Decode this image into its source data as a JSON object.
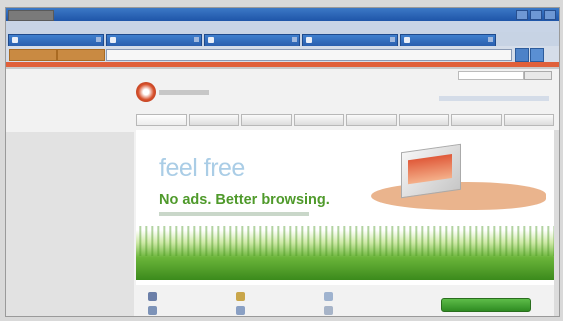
{
  "window": {
    "title": "",
    "controls": [
      "minimize",
      "maximize",
      "close"
    ]
  },
  "menubar": {
    "items": []
  },
  "tabs": [
    {
      "label": ""
    },
    {
      "label": ""
    },
    {
      "label": ""
    },
    {
      "label": ""
    },
    {
      "label": ""
    }
  ],
  "addressbar": {
    "url": ""
  },
  "site": {
    "search_button": "",
    "nav": [
      {
        "label": ""
      },
      {
        "label": ""
      },
      {
        "label": ""
      },
      {
        "label": ""
      },
      {
        "label": ""
      },
      {
        "label": ""
      },
      {
        "label": ""
      },
      {
        "label": ""
      }
    ],
    "hero": {
      "headline": "feel free",
      "tagline": "No ads. Better browsing."
    },
    "features": [
      {
        "label": "",
        "icon": "lock-icon"
      },
      {
        "label": "",
        "icon": "search-icon"
      },
      {
        "label": "",
        "icon": "tabs-icon"
      },
      {
        "label": "",
        "icon": "mail-icon"
      },
      {
        "label": "",
        "icon": "globe-icon"
      },
      {
        "label": "",
        "icon": "gear-icon"
      }
    ],
    "download_label": ""
  },
  "colors": {
    "titlebar": "#2a62b4",
    "brand_orange": "#e0603a",
    "headline_blue": "#aacde6",
    "tagline_green": "#4f9a2b",
    "download_green": "#3fa02f"
  }
}
